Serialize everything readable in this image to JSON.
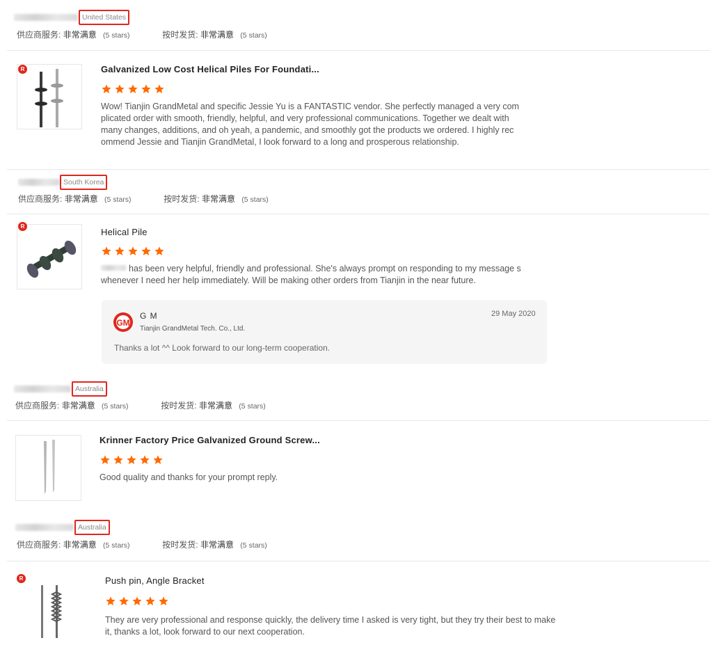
{
  "labels": {
    "supplier_service": "供应商服务:",
    "on_time": "按时发货:",
    "very_satisfied": "非常满意",
    "five_stars": "(5 stars)"
  },
  "reviews": [
    {
      "country": "United States",
      "product": "Galvanized Low Cost Helical Piles For Foundati...",
      "rating": 5,
      "text": "Wow! Tianjin GrandMetal and specific Jessie Yu is a FANTASTIC vendor. She perfectly managed a very com plicated order with smooth, friendly, helpful, and very professional communications. Together we dealt with many changes, additions, and oh yeah, a pandemic, and smoothly got the products we ordered. I highly rec ommend Jessie and Tianjin GrandMetal, I look forward to a long and prosperous relationship."
    },
    {
      "country": "South Korea",
      "product": "Helical Pile",
      "rating": 5,
      "text": "has been very helpful, friendly and professional. She's always prompt on responding to my message s whenever I need her help immediately. Will be making other orders from Tianjin in the near future.",
      "reply": {
        "name": "G M",
        "company": "Tianjin GrandMetal Tech. Co., Ltd.",
        "date": "29 May 2020",
        "text": "Thanks a lot ^^ Look forward to our long-term cooperation."
      }
    },
    {
      "country": "Australia",
      "product": "Krinner Factory Price Galvanized Ground Screw...",
      "rating": 5,
      "text": "Good quality and thanks for your prompt reply."
    },
    {
      "country": "Australia",
      "product": "Push pin, Angle Bracket",
      "rating": 5,
      "text": "They are very professional and response quickly, the delivery time I asked is very tight, but they try their best to make it, thanks a lot, look forward to our next cooperation."
    }
  ],
  "colors": {
    "star": "#ff6a00",
    "highlight": "#e0261c"
  }
}
